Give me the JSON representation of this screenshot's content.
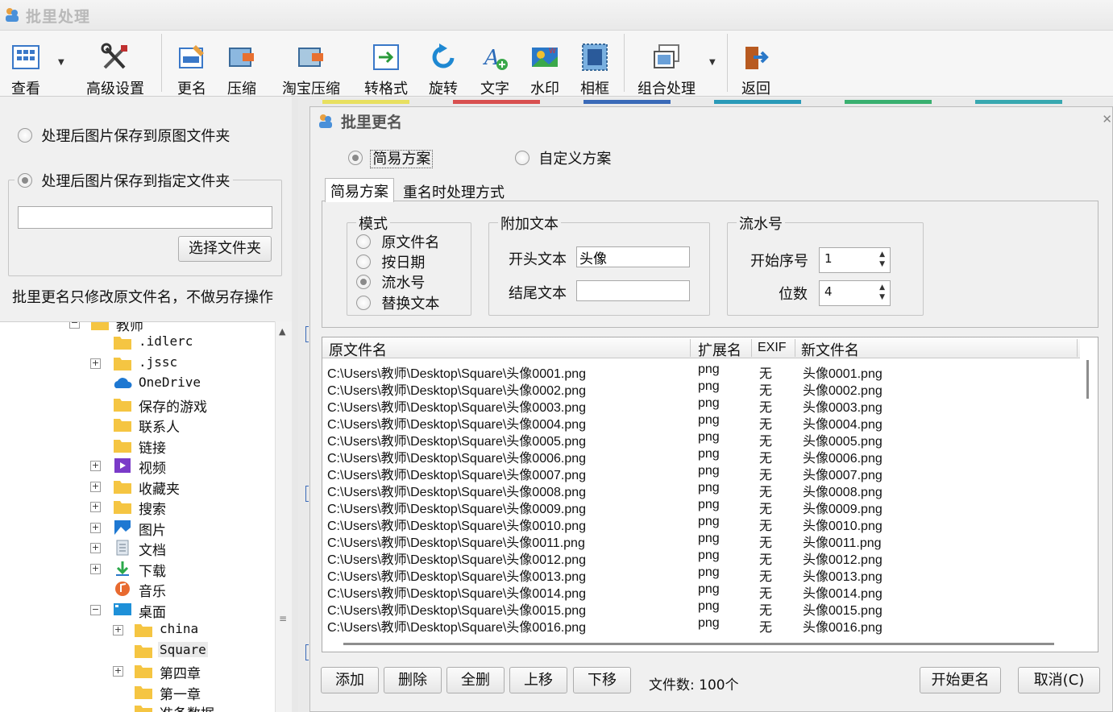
{
  "window": {
    "title": "批里处理"
  },
  "toolbar": {
    "buttons": [
      {
        "label": "查看",
        "icon": "grid-view-icon"
      },
      {
        "label": "高级设置",
        "icon": "tools-icon"
      },
      {
        "label": "更名",
        "icon": "rename-icon"
      },
      {
        "label": "压缩",
        "icon": "compress-icon"
      },
      {
        "label": "淘宝压缩",
        "icon": "taobao-compress-icon"
      },
      {
        "label": "转格式",
        "icon": "convert-format-icon"
      },
      {
        "label": "旋转",
        "icon": "rotate-icon"
      },
      {
        "label": "文字",
        "icon": "text-icon"
      },
      {
        "label": "水印",
        "icon": "watermark-icon"
      },
      {
        "label": "相框",
        "icon": "frame-icon"
      },
      {
        "label": "组合处理",
        "icon": "combine-icon"
      },
      {
        "label": "返回",
        "icon": "return-icon"
      }
    ]
  },
  "save_options": {
    "to_original": "处理后图片保存到原图文件夹",
    "to_specified": "处理后图片保存到指定文件夹",
    "folder_path": "",
    "select_folder_btn": "选择文件夹",
    "note": "批里更名只修改原文件名，不做另存操作"
  },
  "tree": {
    "items": [
      {
        "label": "教师",
        "mono": false
      },
      {
        "label": ".idlerc",
        "mono": true
      },
      {
        "label": ".jssc",
        "mono": true
      },
      {
        "label": "OneDrive",
        "mono": true
      },
      {
        "label": "保存的游戏",
        "mono": false
      },
      {
        "label": "联系人",
        "mono": false
      },
      {
        "label": "链接",
        "mono": false
      },
      {
        "label": "视频",
        "mono": false
      },
      {
        "label": "收藏夹",
        "mono": false
      },
      {
        "label": "搜索",
        "mono": false
      },
      {
        "label": "图片",
        "mono": false
      },
      {
        "label": "文档",
        "mono": false
      },
      {
        "label": "下载",
        "mono": false
      },
      {
        "label": "音乐",
        "mono": false
      },
      {
        "label": "桌面",
        "mono": false
      },
      {
        "label": "china",
        "mono": true
      },
      {
        "label": "Square",
        "mono": true
      },
      {
        "label": "第四章",
        "mono": false
      },
      {
        "label": "第一章",
        "mono": false
      },
      {
        "label": "准备数据",
        "mono": false
      }
    ]
  },
  "dialog": {
    "title": "批里更名",
    "scheme_simple": "简易方案",
    "scheme_custom": "自定义方案",
    "tabs": [
      "简易方案",
      "重名时处理方式"
    ],
    "mode": {
      "legend": "模式",
      "options": [
        "原文件名",
        "按日期",
        "流水号",
        "替换文本"
      ]
    },
    "extra_text": {
      "legend": "附加文本",
      "prefix_label": "开头文本",
      "prefix_value": "头像",
      "suffix_label": "结尾文本",
      "suffix_value": ""
    },
    "serial": {
      "legend": "流水号",
      "start_label": "开始序号",
      "start_value": "1",
      "digits_label": "位数",
      "digits_value": "4"
    },
    "list": {
      "columns": [
        "原文件名",
        "扩展名",
        "EXIF",
        "新文件名"
      ],
      "rows": [
        [
          "C:\\Users\\教师\\Desktop\\Square\\头像0001.png",
          "png",
          "无",
          "头像0001.png"
        ],
        [
          "C:\\Users\\教师\\Desktop\\Square\\头像0002.png",
          "png",
          "无",
          "头像0002.png"
        ],
        [
          "C:\\Users\\教师\\Desktop\\Square\\头像0003.png",
          "png",
          "无",
          "头像0003.png"
        ],
        [
          "C:\\Users\\教师\\Desktop\\Square\\头像0004.png",
          "png",
          "无",
          "头像0004.png"
        ],
        [
          "C:\\Users\\教师\\Desktop\\Square\\头像0005.png",
          "png",
          "无",
          "头像0005.png"
        ],
        [
          "C:\\Users\\教师\\Desktop\\Square\\头像0006.png",
          "png",
          "无",
          "头像0006.png"
        ],
        [
          "C:\\Users\\教师\\Desktop\\Square\\头像0007.png",
          "png",
          "无",
          "头像0007.png"
        ],
        [
          "C:\\Users\\教师\\Desktop\\Square\\头像0008.png",
          "png",
          "无",
          "头像0008.png"
        ],
        [
          "C:\\Users\\教师\\Desktop\\Square\\头像0009.png",
          "png",
          "无",
          "头像0009.png"
        ],
        [
          "C:\\Users\\教师\\Desktop\\Square\\头像0010.png",
          "png",
          "无",
          "头像0010.png"
        ],
        [
          "C:\\Users\\教师\\Desktop\\Square\\头像0011.png",
          "png",
          "无",
          "头像0011.png"
        ],
        [
          "C:\\Users\\教师\\Desktop\\Square\\头像0012.png",
          "png",
          "无",
          "头像0012.png"
        ],
        [
          "C:\\Users\\教师\\Desktop\\Square\\头像0013.png",
          "png",
          "无",
          "头像0013.png"
        ],
        [
          "C:\\Users\\教师\\Desktop\\Square\\头像0014.png",
          "png",
          "无",
          "头像0014.png"
        ],
        [
          "C:\\Users\\教师\\Desktop\\Square\\头像0015.png",
          "png",
          "无",
          "头像0015.png"
        ],
        [
          "C:\\Users\\教师\\Desktop\\Square\\头像0016.png",
          "png",
          "无",
          "头像0016.png"
        ]
      ]
    },
    "buttons": {
      "add": "添加",
      "delete": "删除",
      "delete_all": "全删",
      "move_up": "上移",
      "move_down": "下移",
      "file_count": "文件数: 100个",
      "start": "开始更名",
      "cancel": "取消(C)"
    }
  },
  "colors": {
    "accent_blue": "#1e78d2",
    "folder_yellow": "#f5c542"
  }
}
